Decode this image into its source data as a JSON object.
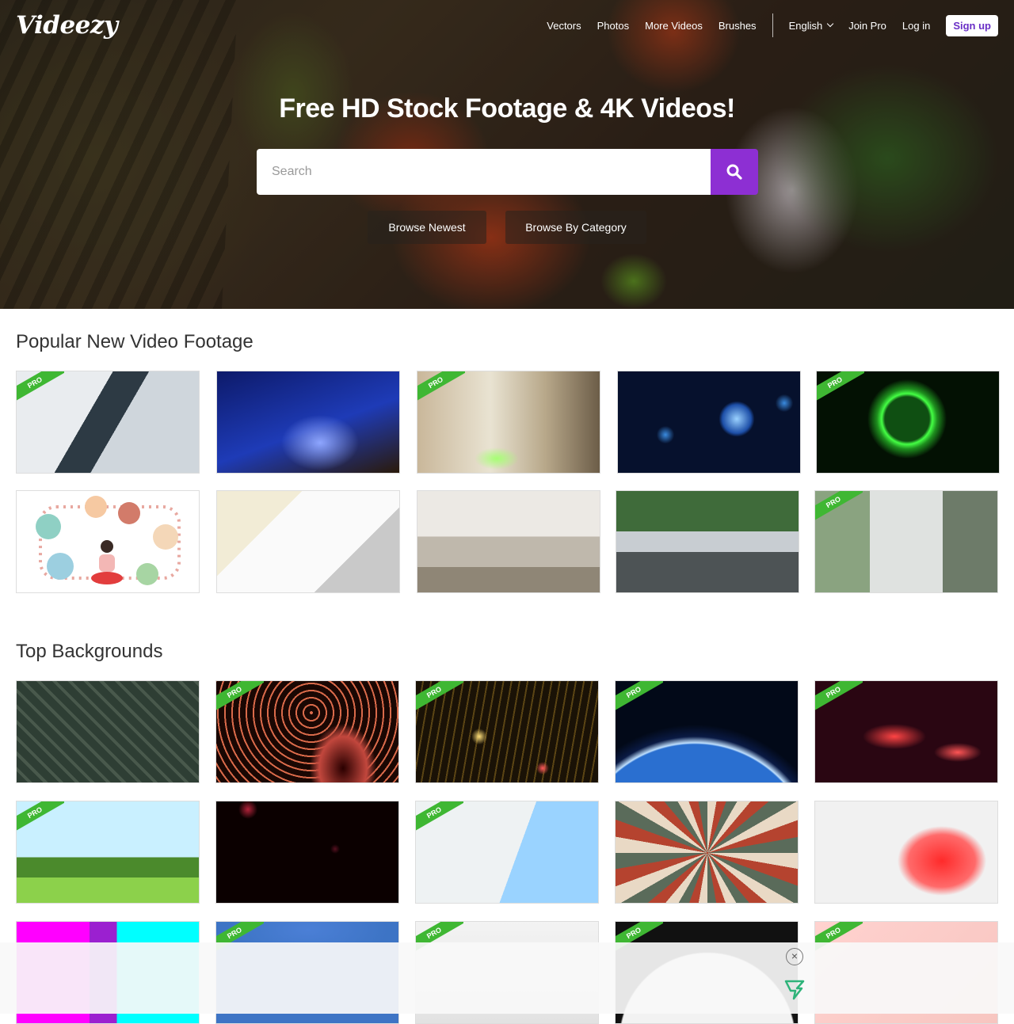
{
  "nav": {
    "logo": "Videezy",
    "links": [
      "Vectors",
      "Photos",
      "More Videos",
      "Brushes"
    ],
    "language": "English",
    "join_pro": "Join Pro",
    "login": "Log in",
    "signup": "Sign up"
  },
  "hero": {
    "title": "Free HD Stock Footage & 4K Videos!",
    "search_placeholder": "Search",
    "browse_newest": "Browse Newest",
    "browse_category": "Browse By Category"
  },
  "sections": {
    "popular_title": "Popular New Video Footage",
    "backgrounds_title": "Top Backgrounds"
  },
  "badge": "PRO",
  "colors": {
    "accent": "#8d2fd3",
    "pro_badge": "#3fb733"
  }
}
